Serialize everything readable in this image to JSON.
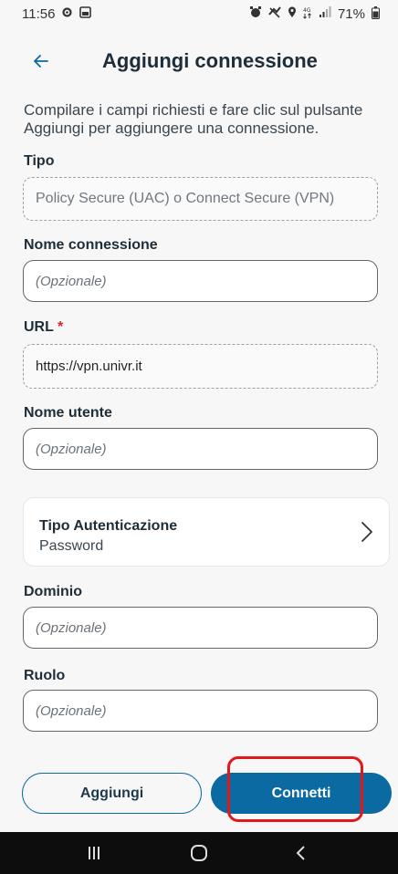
{
  "status_bar": {
    "time": "11:56",
    "battery": "71%",
    "left_icons": [
      "settings-icon",
      "image-icon"
    ],
    "right_icons": [
      "alarm-icon",
      "mute-icon",
      "location-icon",
      "data-4g-icon",
      "signal-icon",
      "battery-icon"
    ]
  },
  "header": {
    "title": "Aggiungi connessione",
    "back_icon": "arrow-left-icon"
  },
  "intro_text": "Compilare i campi richiesti e fare clic sul pulsante Aggiungi per aggiungere una connessione.",
  "form": {
    "tipo": {
      "label": "Tipo",
      "value": "Policy Secure (UAC) o Connect Secure (VPN)"
    },
    "nome_connessione": {
      "label": "Nome connessione",
      "placeholder": "(Opzionale)"
    },
    "url": {
      "label": "URL",
      "required_mark": "*",
      "value": "https://vpn.univr.it"
    },
    "nome_utente": {
      "label": "Nome utente",
      "placeholder": "(Opzionale)"
    },
    "tipo_autenticazione": {
      "label": "Tipo Autenticazione",
      "value": "Password",
      "icon": "chevron-right-icon"
    },
    "dominio": {
      "label": "Dominio",
      "placeholder": "(Opzionale)"
    },
    "ruolo": {
      "label": "Ruolo",
      "placeholder": "(Opzionale)"
    }
  },
  "buttons": {
    "aggiungi": "Aggiungi",
    "connetti": "Connetti"
  },
  "colors": {
    "accent": "#0a6aa1",
    "highlight": "#e3161b",
    "background": "#f7f7f7"
  },
  "nav_bar": {
    "icons": [
      "recents-icon",
      "home-icon",
      "back-icon"
    ]
  }
}
